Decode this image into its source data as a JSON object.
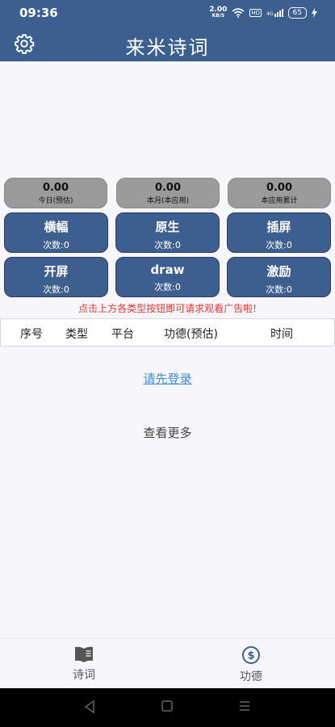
{
  "status_bar": {
    "time": "09:36",
    "net_speed_value": "2.00",
    "net_speed_unit": "KB/S",
    "hd": "HD",
    "signal": "4G",
    "battery": "65"
  },
  "header": {
    "title": "来米诗词"
  },
  "stats": [
    {
      "value": "0.00",
      "label": "今日(预估)"
    },
    {
      "value": "0.00",
      "label": "本月(本应用)"
    },
    {
      "value": "0.00",
      "label": "本应用累计"
    }
  ],
  "ad_buttons": [
    {
      "name": "横幅",
      "count": "次数:0"
    },
    {
      "name": "原生",
      "count": "次数:0"
    },
    {
      "name": "插屏",
      "count": "次数:0"
    },
    {
      "name": "开屏",
      "count": "次数:0"
    },
    {
      "name": "draw",
      "count": "次数:0"
    },
    {
      "name": "激励",
      "count": "次数:0"
    }
  ],
  "notice": "点击上方各类型按钮即可请求观看广告啦!",
  "table": {
    "columns": [
      "序号",
      "类型",
      "平台",
      "功德(预估)",
      "时间"
    ]
  },
  "login_link": "请先登录",
  "view_more": "查看更多",
  "bottom_nav": [
    {
      "label": "诗词",
      "icon": "book-icon"
    },
    {
      "label": "功德",
      "icon": "dollar-circle-icon"
    }
  ],
  "colors": {
    "primary": "#3d5f8f",
    "notice": "#e53935",
    "link": "#3e8fd6"
  }
}
